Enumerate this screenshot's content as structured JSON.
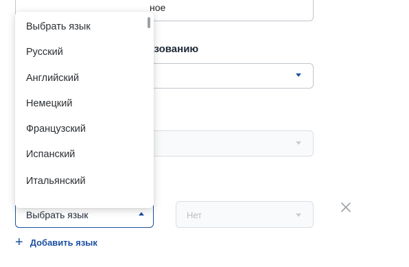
{
  "form": {
    "top_field_value_fragment": "ное",
    "section_label_fragment": "азованию",
    "language_select": {
      "selected_label": "Выбрать язык",
      "options": [
        "Выбрать язык",
        "Русский",
        "Английский",
        "Немецкий",
        "Французский",
        "Испанский",
        "Итальянский"
      ]
    },
    "level_select": {
      "value": "Нет"
    },
    "add_language_label": "Добавить язык"
  },
  "colors": {
    "accent": "#1b4fa3",
    "border": "#bfc5cc",
    "disabled_text": "#b8bec6"
  },
  "icons": {
    "close": "close-icon",
    "add": "plus-icon",
    "caret_down": "chevron-down-icon",
    "caret_up": "chevron-up-icon"
  }
}
